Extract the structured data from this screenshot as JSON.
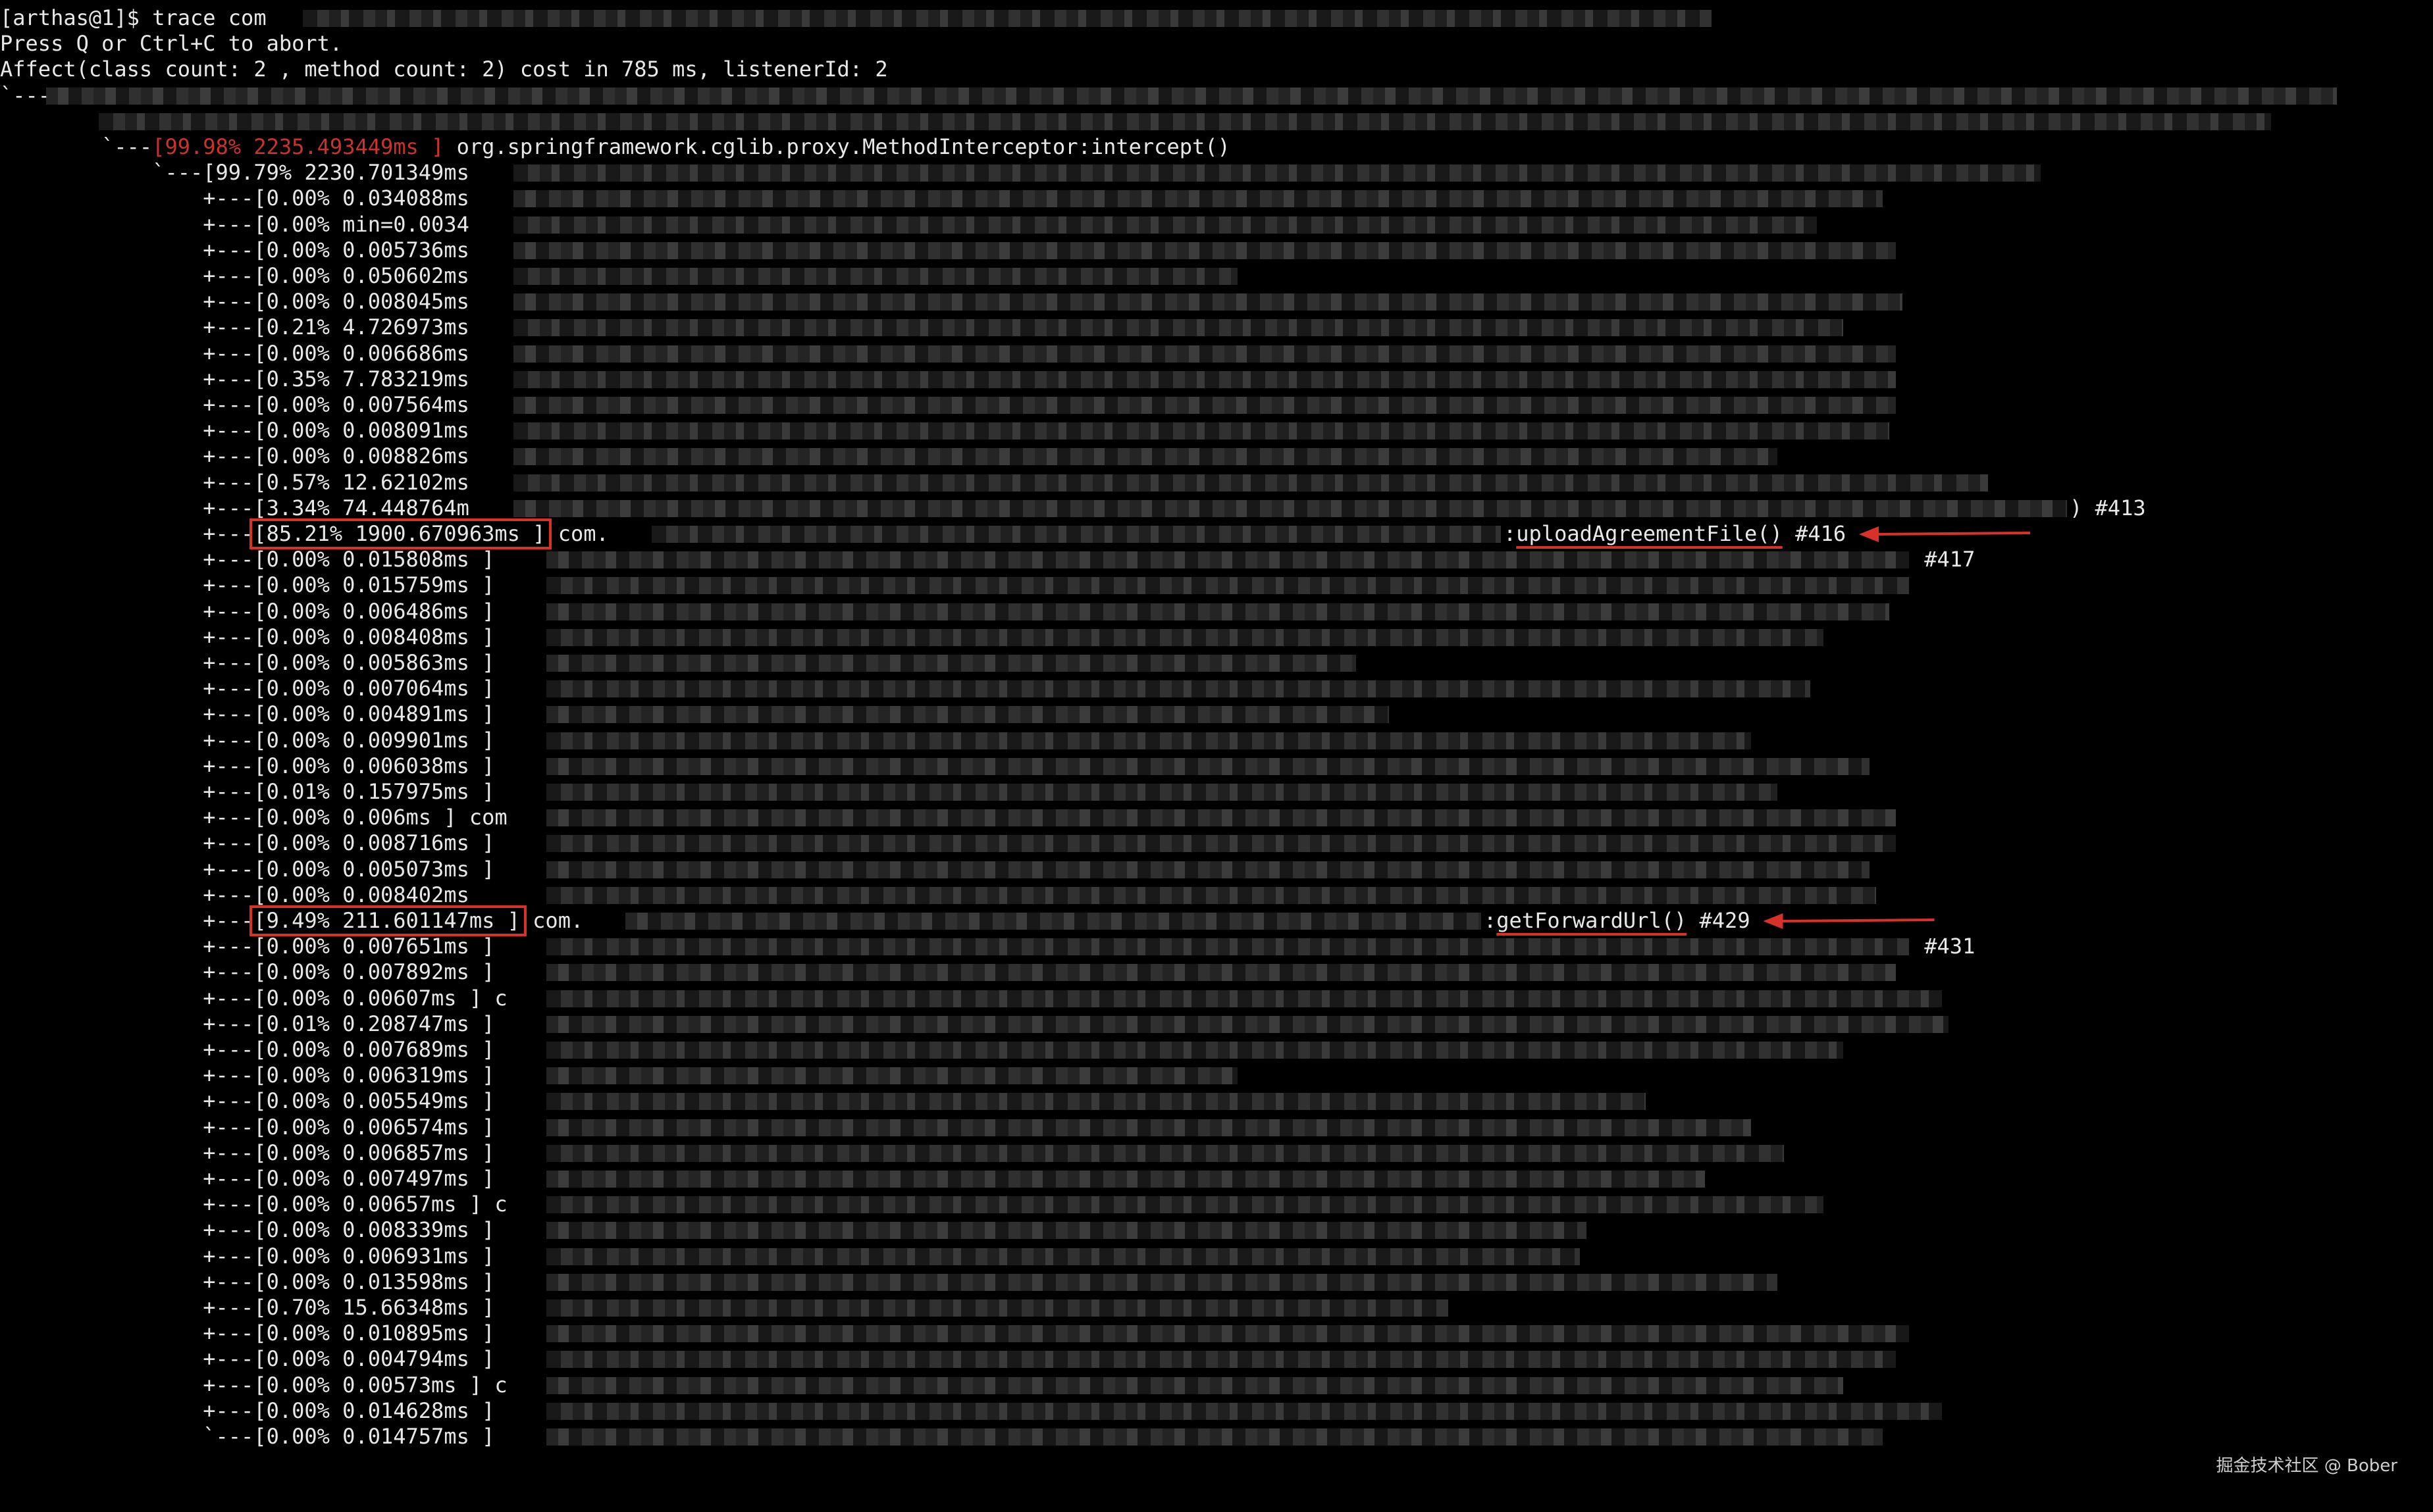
{
  "terminal": {
    "header": [
      {
        "text": "[arthas@1]$ trace com",
        "blur_from": 460,
        "blur_to": 2600
      },
      {
        "text": "Press Q or Ctrl+C to abort."
      },
      {
        "text": "Affect(class count: 2 , method count: 2) cost in 785 ms, listenerId: 2"
      },
      {
        "text": "`---",
        "blur_from": 70,
        "blur_to": 3550
      }
    ],
    "nodes": [
      {
        "prefix": "       ",
        "red": "",
        "text": "",
        "blur_from": 150,
        "blur_to": 3450
      },
      {
        "prefix": "        `---",
        "red": "[99.98% 2235.493449ms ]",
        "text": " org.springframework.cglib.proxy.MethodInterceptor:intercept()",
        "blur_from": 0,
        "blur_to": 0
      },
      {
        "prefix": "            `---",
        "red": "",
        "text": "[99.79% 2230.701349ms",
        "blur_from": 780,
        "blur_to": 3100
      },
      {
        "prefix": "                +---",
        "red": "",
        "text": "[0.00% 0.034088ms",
        "blur_from": 780,
        "blur_to": 2860
      },
      {
        "prefix": "                +---",
        "red": "",
        "text": "[0.00% min=0.0034",
        "blur_from": 780,
        "blur_to": 2760
      },
      {
        "prefix": "                +---",
        "red": "",
        "text": "[0.00% 0.005736ms",
        "blur_from": 780,
        "blur_to": 2880
      },
      {
        "prefix": "                +---",
        "red": "",
        "text": "[0.00% 0.050602ms",
        "blur_from": 780,
        "blur_to": 1880
      },
      {
        "prefix": "                +---",
        "red": "",
        "text": "[0.00% 0.008045ms",
        "blur_from": 780,
        "blur_to": 2890
      },
      {
        "prefix": "                +---",
        "red": "",
        "text": "[0.21% 4.726973ms",
        "blur_from": 780,
        "blur_to": 2800
      },
      {
        "prefix": "                +---",
        "red": "",
        "text": "[0.00% 0.006686ms",
        "blur_from": 780,
        "blur_to": 2880
      },
      {
        "prefix": "                +---",
        "red": "",
        "text": "[0.35% 7.783219ms",
        "blur_from": 780,
        "blur_to": 2880
      },
      {
        "prefix": "                +---",
        "red": "",
        "text": "[0.00% 0.007564ms",
        "blur_from": 780,
        "blur_to": 2880
      },
      {
        "prefix": "                +---",
        "red": "",
        "text": "[0.00% 0.008091ms",
        "blur_from": 780,
        "blur_to": 2870
      },
      {
        "prefix": "                +---",
        "red": "",
        "text": "[0.00% 0.008826ms",
        "blur_from": 780,
        "blur_to": 2700
      },
      {
        "prefix": "                +---",
        "red": "",
        "text": "[0.57% 12.62102ms",
        "blur_from": 780,
        "blur_to": 3020
      },
      {
        "prefix": "                +---",
        "red": "",
        "text": "[3.34% 74.448764m",
        "blur_from": 780,
        "blur_to": 3140,
        "suffix": ") #413"
      },
      {
        "prefix": "                +---",
        "red": "",
        "text": "[85.21% 1900.670963ms ] com.",
        "blur_from": 990,
        "blur_to": 2280,
        "suffix": ":uploadAgreementFile() #416",
        "highlight": true
      },
      {
        "prefix": "                +---",
        "red": "",
        "text": "[0.00% 0.015808ms ]",
        "blur_from": 830,
        "blur_to": 2900,
        "suffix": " #417"
      },
      {
        "prefix": "                +---",
        "red": "",
        "text": "[0.00% 0.015759ms ]",
        "blur_from": 830,
        "blur_to": 2900
      },
      {
        "prefix": "                +---",
        "red": "",
        "text": "[0.00% 0.006486ms ]",
        "blur_from": 830,
        "blur_to": 2870
      },
      {
        "prefix": "                +---",
        "red": "",
        "text": "[0.00% 0.008408ms ]",
        "blur_from": 830,
        "blur_to": 2770
      },
      {
        "prefix": "                +---",
        "red": "",
        "text": "[0.00% 0.005863ms ]",
        "blur_from": 830,
        "blur_to": 2060
      },
      {
        "prefix": "                +---",
        "red": "",
        "text": "[0.00% 0.007064ms ]",
        "blur_from": 830,
        "blur_to": 2750
      },
      {
        "prefix": "                +---",
        "red": "",
        "text": "[0.00% 0.004891ms ]",
        "blur_from": 830,
        "blur_to": 2110
      },
      {
        "prefix": "                +---",
        "red": "",
        "text": "[0.00% 0.009901ms ]",
        "blur_from": 830,
        "blur_to": 2660
      },
      {
        "prefix": "                +---",
        "red": "",
        "text": "[0.00% 0.006038ms ]",
        "blur_from": 830,
        "blur_to": 2840
      },
      {
        "prefix": "                +---",
        "red": "",
        "text": "[0.01% 0.157975ms ]",
        "blur_from": 830,
        "blur_to": 2700
      },
      {
        "prefix": "                +---",
        "red": "",
        "text": "[0.00% 0.006ms ] com",
        "blur_from": 830,
        "blur_to": 2880
      },
      {
        "prefix": "                +---",
        "red": "",
        "text": "[0.00% 0.008716ms ]",
        "blur_from": 830,
        "blur_to": 2880
      },
      {
        "prefix": "                +---",
        "red": "",
        "text": "[0.00% 0.005073ms ]",
        "blur_from": 830,
        "blur_to": 2840
      },
      {
        "prefix": "                +---",
        "red": "",
        "text": "[0.00% 0.008402ms",
        "blur_from": 830,
        "blur_to": 2850
      },
      {
        "prefix": "                +---",
        "red": "",
        "text": "[9.49% 211.601147ms ] com.",
        "blur_from": 950,
        "blur_to": 2250,
        "suffix": ":getForwardUrl() #429",
        "highlight": true
      },
      {
        "prefix": "                +---",
        "red": "",
        "text": "[0.00% 0.007651ms ]",
        "blur_from": 830,
        "blur_to": 2900,
        "suffix": " #431"
      },
      {
        "prefix": "                +---",
        "red": "",
        "text": "[0.00% 0.007892ms ]",
        "blur_from": 830,
        "blur_to": 2880
      },
      {
        "prefix": "                +---",
        "red": "",
        "text": "[0.00% 0.00607ms ] c",
        "blur_from": 830,
        "blur_to": 2950
      },
      {
        "prefix": "                +---",
        "red": "",
        "text": "[0.01% 0.208747ms ]",
        "blur_from": 830,
        "blur_to": 2960
      },
      {
        "prefix": "                +---",
        "red": "",
        "text": "[0.00% 0.007689ms ]",
        "blur_from": 830,
        "blur_to": 2800
      },
      {
        "prefix": "                +---",
        "red": "",
        "text": "[0.00% 0.006319ms ]",
        "blur_from": 830,
        "blur_to": 1880
      },
      {
        "prefix": "                +---",
        "red": "",
        "text": "[0.00% 0.005549ms ]",
        "blur_from": 830,
        "blur_to": 2500
      },
      {
        "prefix": "                +---",
        "red": "",
        "text": "[0.00% 0.006574ms ]",
        "blur_from": 830,
        "blur_to": 2660
      },
      {
        "prefix": "                +---",
        "red": "",
        "text": "[0.00% 0.006857ms ]",
        "blur_from": 830,
        "blur_to": 2710
      },
      {
        "prefix": "                +---",
        "red": "",
        "text": "[0.00% 0.007497ms ]",
        "blur_from": 830,
        "blur_to": 2590
      },
      {
        "prefix": "                +---",
        "red": "",
        "text": "[0.00% 0.00657ms ] c",
        "blur_from": 830,
        "blur_to": 2770
      },
      {
        "prefix": "                +---",
        "red": "",
        "text": "[0.00% 0.008339ms ]",
        "blur_from": 830,
        "blur_to": 2410
      },
      {
        "prefix": "                +---",
        "red": "",
        "text": "[0.00% 0.006931ms ]",
        "blur_from": 830,
        "blur_to": 2400
      },
      {
        "prefix": "                +---",
        "red": "",
        "text": "[0.00% 0.013598ms ]",
        "blur_from": 830,
        "blur_to": 2700
      },
      {
        "prefix": "                +---",
        "red": "",
        "text": "[0.70% 15.66348ms ]",
        "blur_from": 830,
        "blur_to": 2200
      },
      {
        "prefix": "                +---",
        "red": "",
        "text": "[0.00% 0.010895ms ]",
        "blur_from": 830,
        "blur_to": 2900
      },
      {
        "prefix": "                +---",
        "red": "",
        "text": "[0.00% 0.004794ms ]",
        "blur_from": 830,
        "blur_to": 2880
      },
      {
        "prefix": "                +---",
        "red": "",
        "text": "[0.00% 0.00573ms ] c",
        "blur_from": 830,
        "blur_to": 2800
      },
      {
        "prefix": "                +---",
        "red": "",
        "text": "[0.00% 0.014628ms ]",
        "blur_from": 830,
        "blur_to": 2950
      },
      {
        "prefix": "                `---",
        "red": "",
        "text": "[0.00% 0.014757ms ]",
        "blur_from": 830,
        "blur_to": 2860
      }
    ]
  },
  "watermark": "掘金技术社区 @ Bober",
  "colors": {
    "background": "#000000",
    "foreground": "#e8e8e8",
    "annotation_red": "#d9302a"
  }
}
